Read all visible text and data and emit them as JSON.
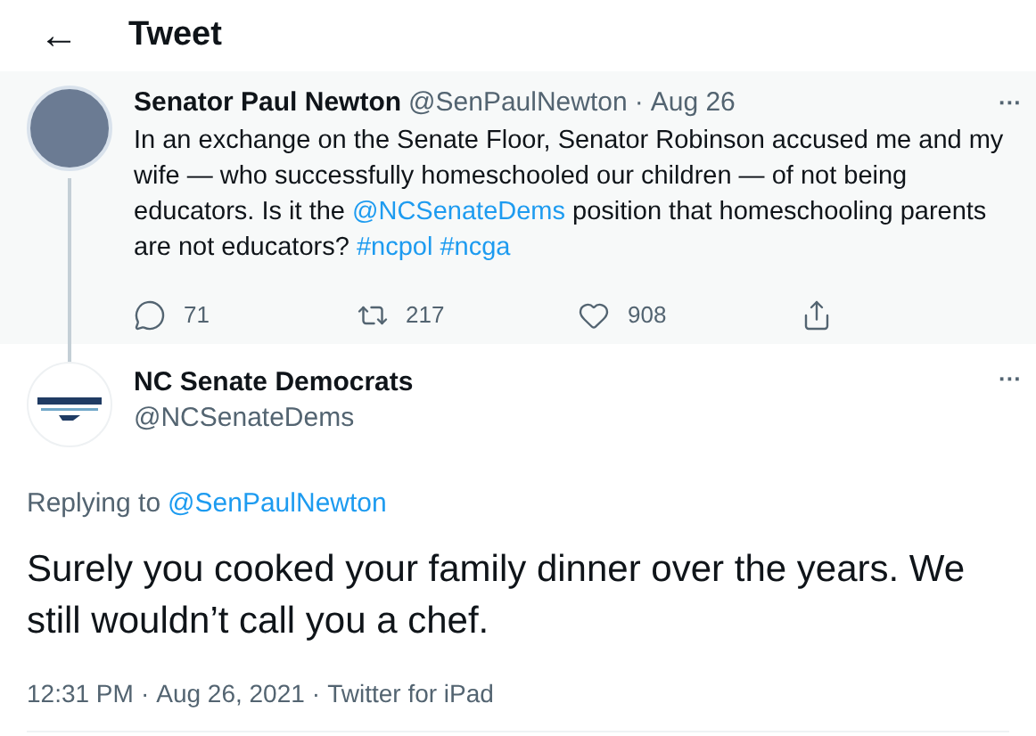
{
  "header": {
    "back": "←",
    "title": "Tweet"
  },
  "parent_tweet": {
    "name": "Senator Paul Newton",
    "handle": "@SenPaulNewton",
    "separator": "·",
    "date": "Aug 26",
    "more": "···",
    "body": [
      {
        "kind": "text",
        "text": "In an exchange on the Senate Floor, Senator Robinson accused me and my wife — who successfully homeschooled our children — of not being educators. Is it the "
      },
      {
        "kind": "link",
        "text": "@NCSenateDems"
      },
      {
        "kind": "text",
        "text": " position that homeschooling parents are not educators? "
      },
      {
        "kind": "link",
        "text": "#ncpol"
      },
      {
        "kind": "link",
        "text": "#ncga"
      }
    ],
    "actions": [
      {
        "kind": "reply",
        "count": "71"
      },
      {
        "kind": "retweet",
        "count": "217"
      },
      {
        "kind": "like",
        "count": "908"
      },
      {
        "kind": "share"
      }
    ]
  },
  "tweet": {
    "name": "NC Senate Democrats",
    "handle": "@NCSenateDems",
    "more": "···",
    "replying_to_label": "Replying to",
    "replying_to": "@SenPaulNewton",
    "text": "Surely you cooked your family dinner over the years. We still wouldn’t call you a chef.",
    "time": "12:31 PM",
    "date": "Aug 26, 2021",
    "source": "Twitter for iPad",
    "separator": "·"
  }
}
